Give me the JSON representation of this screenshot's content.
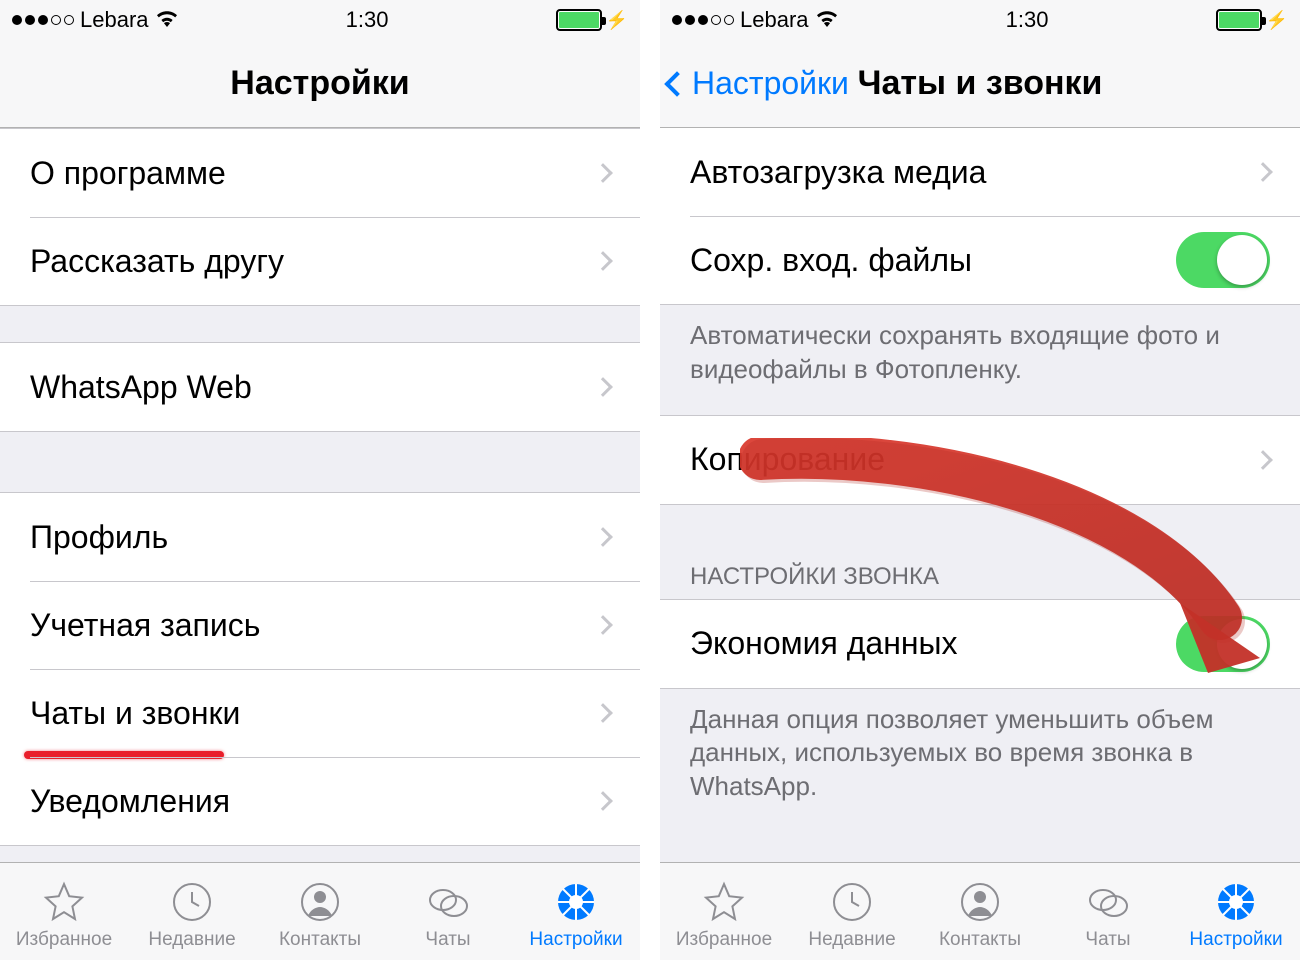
{
  "status": {
    "carrier": "Lebara",
    "time": "1:30"
  },
  "left": {
    "nav_title": "Настройки",
    "rows": {
      "about": "О программе",
      "tell_friend": "Рассказать другу",
      "whatsapp_web": "WhatsApp Web",
      "profile": "Профиль",
      "account": "Учетная запись",
      "chats_calls": "Чаты и звонки",
      "notifications": "Уведомления"
    }
  },
  "right": {
    "back_label": "Настройки",
    "nav_title": "Чаты и звонки",
    "rows": {
      "auto_download": "Автозагрузка медиа",
      "save_incoming": "Сохр. вход. файлы",
      "backup": "Копирование",
      "data_saver": "Экономия данных"
    },
    "footer_save": "Автоматически сохранять входящие фото и видеофайлы в Фотопленку.",
    "section_call": "НАСТРОЙКИ ЗВОНКА",
    "footer_data": "Данная опция позволяет уменьшить объем данных, используемых во время звонка в WhatsApp."
  },
  "tabs": {
    "favorites": "Избранное",
    "recent": "Недавние",
    "contacts": "Контакты",
    "chats": "Чаты",
    "settings": "Настройки"
  }
}
